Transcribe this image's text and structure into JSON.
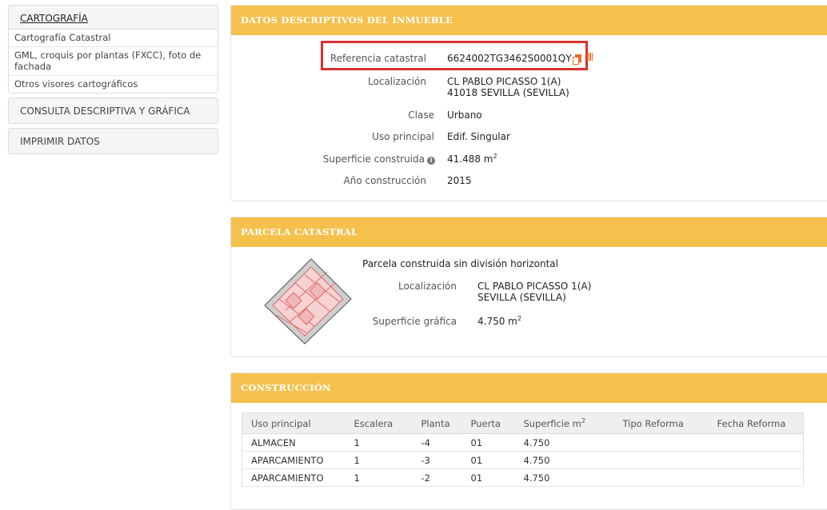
{
  "sidebar": {
    "cartografia": {
      "title": "CARTOGRAFÍA",
      "items": [
        "Cartografía Catastral",
        "GML, croquis por plantas (FXCC), foto de fachada",
        "Otros visores cartográficos"
      ]
    },
    "consulta": "CONSULTA DESCRIPTIVA Y GRÁFICA",
    "imprimir": "IMPRIMIR DATOS"
  },
  "datos": {
    "header": "DATOS DESCRIPTIVOS DEL INMUEBLE",
    "referencia_label": "Referencia catastral",
    "referencia_value": "6624002TG3462S0001QY",
    "localizacion_label": "Localización",
    "localizacion_line1": "CL PABLO PICASSO 1(A)",
    "localizacion_line2": "41018 SEVILLA (SEVILLA)",
    "clase_label": "Clase",
    "clase_value": "Urbano",
    "uso_label": "Uso principal",
    "uso_value": "Edif. Singular",
    "superficie_label": "Superficie construida",
    "superficie_value": "41.488 m",
    "superficie_sup": "2",
    "anio_label": "Año construcción",
    "anio_value": "2015"
  },
  "parcela": {
    "header": "PARCELA CATASTRAL",
    "tipo": "Parcela construida sin división horizontal",
    "localizacion_label": "Localización",
    "localizacion_line1": "CL PABLO PICASSO 1(A)",
    "localizacion_line2": "SEVILLA (SEVILLA)",
    "superficie_label": "Superficie gráfica",
    "superficie_value": "4.750 m",
    "superficie_sup": "2"
  },
  "construccion": {
    "header": "CONSTRUCCIÓN",
    "columns": [
      "Uso principal",
      "Escalera",
      "Planta",
      "Puerta",
      "Superficie m",
      "Tipo Reforma",
      "Fecha Reforma"
    ],
    "superficie_col_sup": "2",
    "rows": [
      [
        "ALMACEN",
        "1",
        "-4",
        "01",
        "4.750",
        "",
        ""
      ],
      [
        "APARCAMIENTO",
        "1",
        "-3",
        "01",
        "4.750",
        "",
        ""
      ],
      [
        "APARCAMIENTO",
        "1",
        "-2",
        "01",
        "4.750",
        "",
        ""
      ]
    ]
  },
  "colors": {
    "header": "#f6c04d",
    "highlight": "#d9322f",
    "icon": "#f06c1f"
  },
  "icons": [
    "copy-icon",
    "info-icon",
    "bars-icon"
  ]
}
